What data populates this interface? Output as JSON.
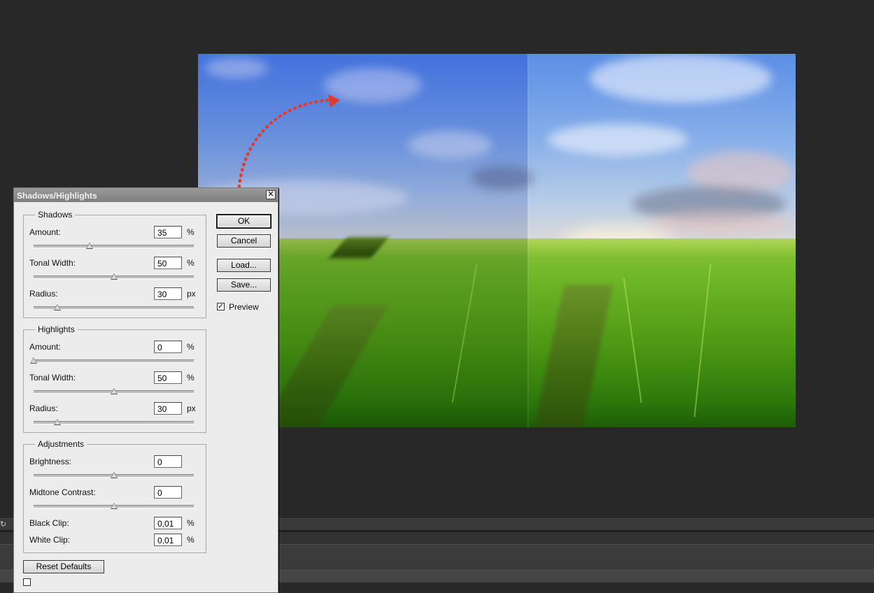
{
  "dialog": {
    "title": "Shadows/Highlights",
    "close_glyph": "✕",
    "shadows": {
      "legend": "Shadows",
      "amount": {
        "label": "Amount:",
        "value": "35",
        "unit": "%",
        "level": 0.35
      },
      "tonal_width": {
        "label": "Tonal Width:",
        "value": "50",
        "unit": "%",
        "level": 0.5
      },
      "radius": {
        "label": "Radius:",
        "value": "30",
        "unit": "px",
        "level": 0.15
      }
    },
    "highlights": {
      "legend": "Highlights",
      "amount": {
        "label": "Amount:",
        "value": "0",
        "unit": "%",
        "level": 0.0
      },
      "tonal_width": {
        "label": "Tonal Width:",
        "value": "50",
        "unit": "%",
        "level": 0.5
      },
      "radius": {
        "label": "Radius:",
        "value": "30",
        "unit": "px",
        "level": 0.15
      }
    },
    "adjustments": {
      "legend": "Adjustments",
      "brightness": {
        "label": "Brightness:",
        "value": "0",
        "level": 0.5
      },
      "midtone_contrast": {
        "label": "Midtone Contrast:",
        "value": "0",
        "level": 0.5
      },
      "black_clip": {
        "label": "Black Clip:",
        "value": "0,01",
        "unit": "%"
      },
      "white_clip": {
        "label": "White Clip:",
        "value": "0,01",
        "unit": "%"
      }
    },
    "buttons": {
      "ok": "OK",
      "cancel": "Cancel",
      "load": "Load...",
      "save": "Save...",
      "reset_defaults": "Reset Defaults"
    },
    "preview": {
      "label": "Preview",
      "checked": true,
      "check_glyph": "✓"
    }
  },
  "canvas": {
    "annotation": "dotted red arrow",
    "arrow_color": "#e03c31"
  },
  "colors": {
    "workspace_bg": "#282828",
    "dialog_bg": "#ececec",
    "titlebar": "#8c8c8c"
  }
}
